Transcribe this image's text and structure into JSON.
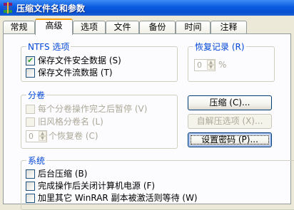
{
  "window": {
    "title": "压缩文件名和参数"
  },
  "tabs": [
    {
      "label": "常规"
    },
    {
      "label": "高级"
    },
    {
      "label": "选项"
    },
    {
      "label": "文件"
    },
    {
      "label": "备份"
    },
    {
      "label": "时间"
    },
    {
      "label": "注释"
    }
  ],
  "ntfs": {
    "legend": "NTFS 选项",
    "security": {
      "label": "保存文件安全数据 (S)",
      "checked": true
    },
    "streams": {
      "label": "保存文件流数据 (T)",
      "checked": false
    }
  },
  "recovery": {
    "legend": "恢复记录 (R)",
    "value": "0",
    "unit": "%"
  },
  "volumes": {
    "legend": "分卷",
    "pause": {
      "label": "每个分卷操作完之后暂停 (V)",
      "checked": false
    },
    "oldstyle": {
      "label": "旧风格分卷名 (L)",
      "checked": false
    },
    "recovery_volumes": {
      "value": "0",
      "label": "个恢复卷 (C)"
    }
  },
  "buttons": {
    "compression": "压缩 (C)...",
    "sfx": "自解压选项 (X)...",
    "password": "设置密码 (P)..."
  },
  "system": {
    "legend": "系统",
    "background": {
      "label": "后台压缩 (B)",
      "checked": false
    },
    "shutdown": {
      "label": "完成操作后关闭计算机电源 (F)",
      "checked": false
    },
    "third": {
      "label": "加里其它 WinRAR 副本被激活则等待 (W)",
      "checked": false
    }
  },
  "colors": {
    "accent": "#0046d5",
    "title_bar": "#0a5ae0",
    "tab_highlight": "#f7a10c"
  }
}
